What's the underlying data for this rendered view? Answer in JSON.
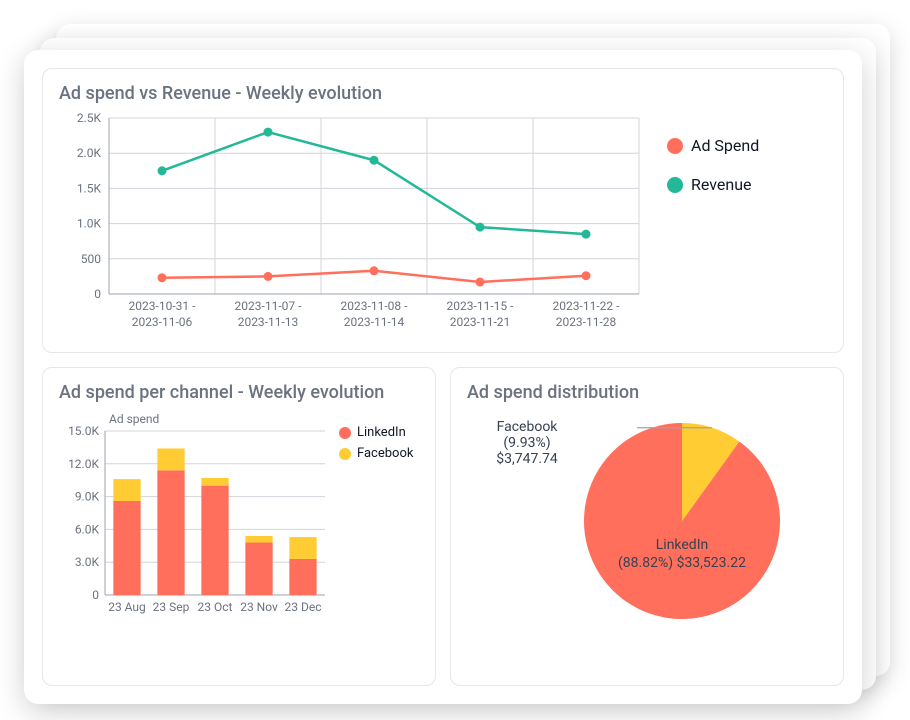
{
  "panels": {
    "top": {
      "title": "Ad spend vs Revenue - Weekly evolution"
    },
    "bottom_left": {
      "title": "Ad spend per channel - Weekly evolution",
      "subtitle": "Ad spend"
    },
    "bottom_right": {
      "title": "Ad spend distribution"
    }
  },
  "legend": {
    "ad_spend": "Ad Spend",
    "revenue": "Revenue",
    "linkedin": "LinkedIn",
    "facebook": "Facebook"
  },
  "colors": {
    "ad_spend": "#ff6f5c",
    "revenue": "#22b898",
    "linkedin": "#ff6f5c",
    "facebook": "#ffcc33",
    "grid": "#d1d5db"
  },
  "pie_labels": {
    "facebook_name": "Facebook",
    "facebook_pct": "(9.93%)",
    "facebook_amount": "$3,747.74",
    "linkedin_name": "LinkedIn",
    "linkedin_pct_amount": "(88.82%) $33,523.22"
  },
  "chart_data": [
    {
      "id": "weekly_line",
      "type": "line",
      "title": "Ad spend vs Revenue - Weekly evolution",
      "categories": [
        "2023-10-31 - 2023-11-06",
        "2023-11-07 - 2023-11-13",
        "2023-11-08 - 2023-11-14",
        "2023-11-15 - 2023-11-21",
        "2023-11-22 - 2023-11-28"
      ],
      "series": [
        {
          "name": "Ad Spend",
          "color": "#ff6f5c",
          "values": [
            230,
            250,
            330,
            170,
            260
          ]
        },
        {
          "name": "Revenue",
          "color": "#22b898",
          "values": [
            1750,
            2300,
            1900,
            950,
            850
          ]
        }
      ],
      "ylim": [
        0,
        2500
      ],
      "yticks": [
        0,
        500,
        1000,
        1500,
        2000,
        2500
      ],
      "ytick_labels": [
        "0",
        "500",
        "1.0K",
        "1.5K",
        "2.0K",
        "2.5K"
      ]
    },
    {
      "id": "channel_bar",
      "type": "bar",
      "title": "Ad spend per channel - Weekly evolution",
      "subtitle": "Ad spend",
      "categories": [
        "23 Aug",
        "23 Sep",
        "23 Oct",
        "23 Nov",
        "23 Dec"
      ],
      "series": [
        {
          "name": "LinkedIn",
          "color": "#ff6f5c",
          "values": [
            8600,
            11400,
            10000,
            4800,
            3300
          ]
        },
        {
          "name": "Facebook",
          "color": "#ffcc33",
          "values": [
            2000,
            2000,
            700,
            600,
            2000
          ]
        }
      ],
      "stacked": true,
      "ylim": [
        0,
        15000
      ],
      "yticks": [
        0,
        3000,
        6000,
        9000,
        12000,
        15000
      ],
      "ytick_labels": [
        "0",
        "3.0K",
        "6.0K",
        "9.0K",
        "12.0K",
        "15.0K"
      ]
    },
    {
      "id": "spend_pie",
      "type": "pie",
      "title": "Ad spend distribution",
      "slices": [
        {
          "name": "LinkedIn",
          "color": "#ff6f5c",
          "value": 33523.22,
          "pct": 88.82
        },
        {
          "name": "Facebook",
          "color": "#ffcc33",
          "value": 3747.74,
          "pct": 9.93
        }
      ]
    }
  ]
}
